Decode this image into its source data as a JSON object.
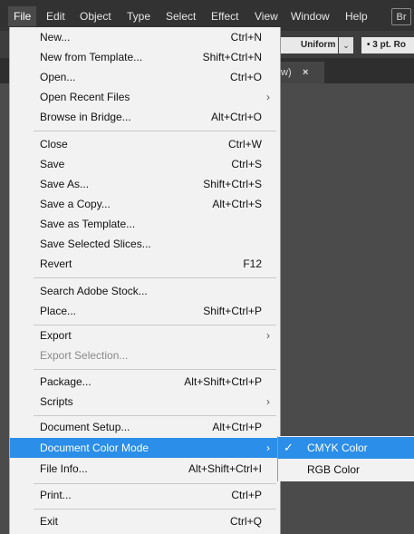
{
  "menubar": {
    "items": [
      "File",
      "Edit",
      "Object",
      "Type",
      "Select",
      "Effect",
      "View",
      "Window",
      "Help"
    ],
    "badge": "Br"
  },
  "control_bar": {
    "stroke_profile": "Uniform",
    "stroke_profile_dropdown": "⌄",
    "brush": "•  3 pt. Ro"
  },
  "tab": {
    "label": "w)",
    "close": "×"
  },
  "file_menu": {
    "items": [
      {
        "label": "New...",
        "shortcut": "Ctrl+N"
      },
      {
        "label": "New from Template...",
        "shortcut": "Shift+Ctrl+N"
      },
      {
        "label": "Open...",
        "shortcut": "Ctrl+O"
      },
      {
        "label": "Open Recent Files",
        "submenu": "›"
      },
      {
        "label": "Browse in Bridge...",
        "shortcut": "Alt+Ctrl+O"
      },
      {
        "label": "Close",
        "shortcut": "Ctrl+W"
      },
      {
        "label": "Save",
        "shortcut": "Ctrl+S"
      },
      {
        "label": "Save As...",
        "shortcut": "Shift+Ctrl+S"
      },
      {
        "label": "Save a Copy...",
        "shortcut": "Alt+Ctrl+S"
      },
      {
        "label": "Save as Template..."
      },
      {
        "label": "Save Selected Slices..."
      },
      {
        "label": "Revert",
        "shortcut": "F12"
      },
      {
        "label": "Search Adobe Stock..."
      },
      {
        "label": "Place...",
        "shortcut": "Shift+Ctrl+P"
      },
      {
        "label": "Export",
        "submenu": "›"
      },
      {
        "label": "Export Selection...",
        "disabled": true
      },
      {
        "label": "Package...",
        "shortcut": "Alt+Shift+Ctrl+P"
      },
      {
        "label": "Scripts",
        "submenu": "›"
      },
      {
        "label": "Document Setup...",
        "shortcut": "Alt+Ctrl+P"
      },
      {
        "label": "Document Color Mode",
        "submenu": "›",
        "highlighted": true
      },
      {
        "label": "File Info...",
        "shortcut": "Alt+Shift+Ctrl+I"
      },
      {
        "label": "Print...",
        "shortcut": "Ctrl+P"
      },
      {
        "label": "Exit",
        "shortcut": "Ctrl+Q"
      }
    ]
  },
  "color_mode_submenu": {
    "items": [
      {
        "label": "CMYK Color",
        "checked": true,
        "check_mark": "✓"
      },
      {
        "label": "RGB Color",
        "checked": false
      }
    ]
  },
  "colors": {
    "menubar_bg": "#323232",
    "menu_bg": "#f2f2f2",
    "highlight": "#2b8ee8",
    "workspace_bg": "#4b4b4b"
  }
}
